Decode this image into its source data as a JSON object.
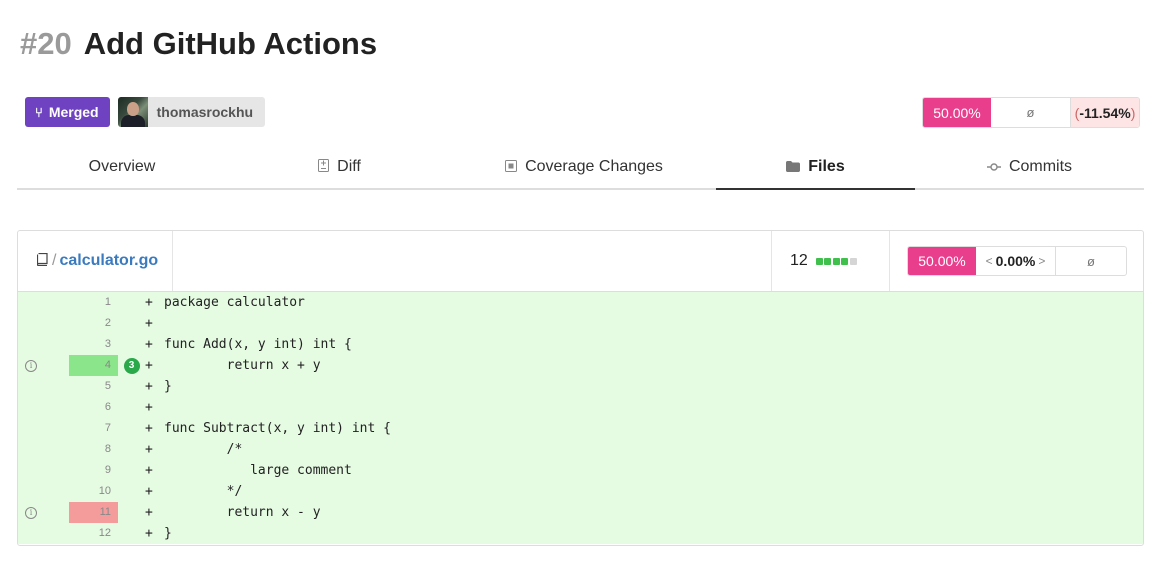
{
  "pr": {
    "number": "#20",
    "title": "Add GitHub Actions"
  },
  "status": {
    "label": "Merged",
    "icon": "merge-icon",
    "color": "#6f42c1"
  },
  "author": {
    "name": "thomasrockhu"
  },
  "coverage": {
    "head": "50.00%",
    "patch": "ø",
    "delta": "-11.54%",
    "delta_open": "(",
    "delta_close": ")",
    "accent": "#e83e8c"
  },
  "tabs": [
    {
      "label": "Overview",
      "icon": ""
    },
    {
      "label": "Diff",
      "icon": "file-diff-icon"
    },
    {
      "label": "Coverage Changes",
      "icon": "coverage-icon"
    },
    {
      "label": "Files",
      "icon": "folder-icon"
    },
    {
      "label": "Commits",
      "icon": "commit-icon"
    }
  ],
  "active_tab": "Files",
  "file": {
    "sep": "/",
    "name": "calculator.go",
    "lines": "12",
    "coverage_blocks": 5,
    "coverage_blocks_filled": 4,
    "coverage": "50.00%",
    "change": "0.00%",
    "change_left": "<",
    "change_right": ">",
    "null": "ø"
  },
  "code": {
    "plus": "+",
    "lines": [
      {
        "n": "1",
        "text": "package calculator",
        "status": "",
        "hits": ""
      },
      {
        "n": "2",
        "text": "",
        "status": "",
        "hits": ""
      },
      {
        "n": "3",
        "text": "func Add(x, y int) int {",
        "status": "",
        "hits": ""
      },
      {
        "n": "4",
        "text": "        return x + y",
        "status": "hit",
        "hits": "3"
      },
      {
        "n": "5",
        "text": "}",
        "status": "",
        "hits": ""
      },
      {
        "n": "6",
        "text": "",
        "status": "",
        "hits": ""
      },
      {
        "n": "7",
        "text": "func Subtract(x, y int) int {",
        "status": "",
        "hits": ""
      },
      {
        "n": "8",
        "text": "        /*",
        "status": "",
        "hits": ""
      },
      {
        "n": "9",
        "text": "           large comment",
        "status": "",
        "hits": ""
      },
      {
        "n": "10",
        "text": "        */",
        "status": "",
        "hits": ""
      },
      {
        "n": "11",
        "text": "        return x - y",
        "status": "miss",
        "hits": ""
      },
      {
        "n": "12",
        "text": "}",
        "status": "",
        "hits": ""
      }
    ]
  },
  "colors": {
    "hit": "#8be58a",
    "miss": "#f49c9c",
    "added_bg": "#e5fbe2"
  }
}
